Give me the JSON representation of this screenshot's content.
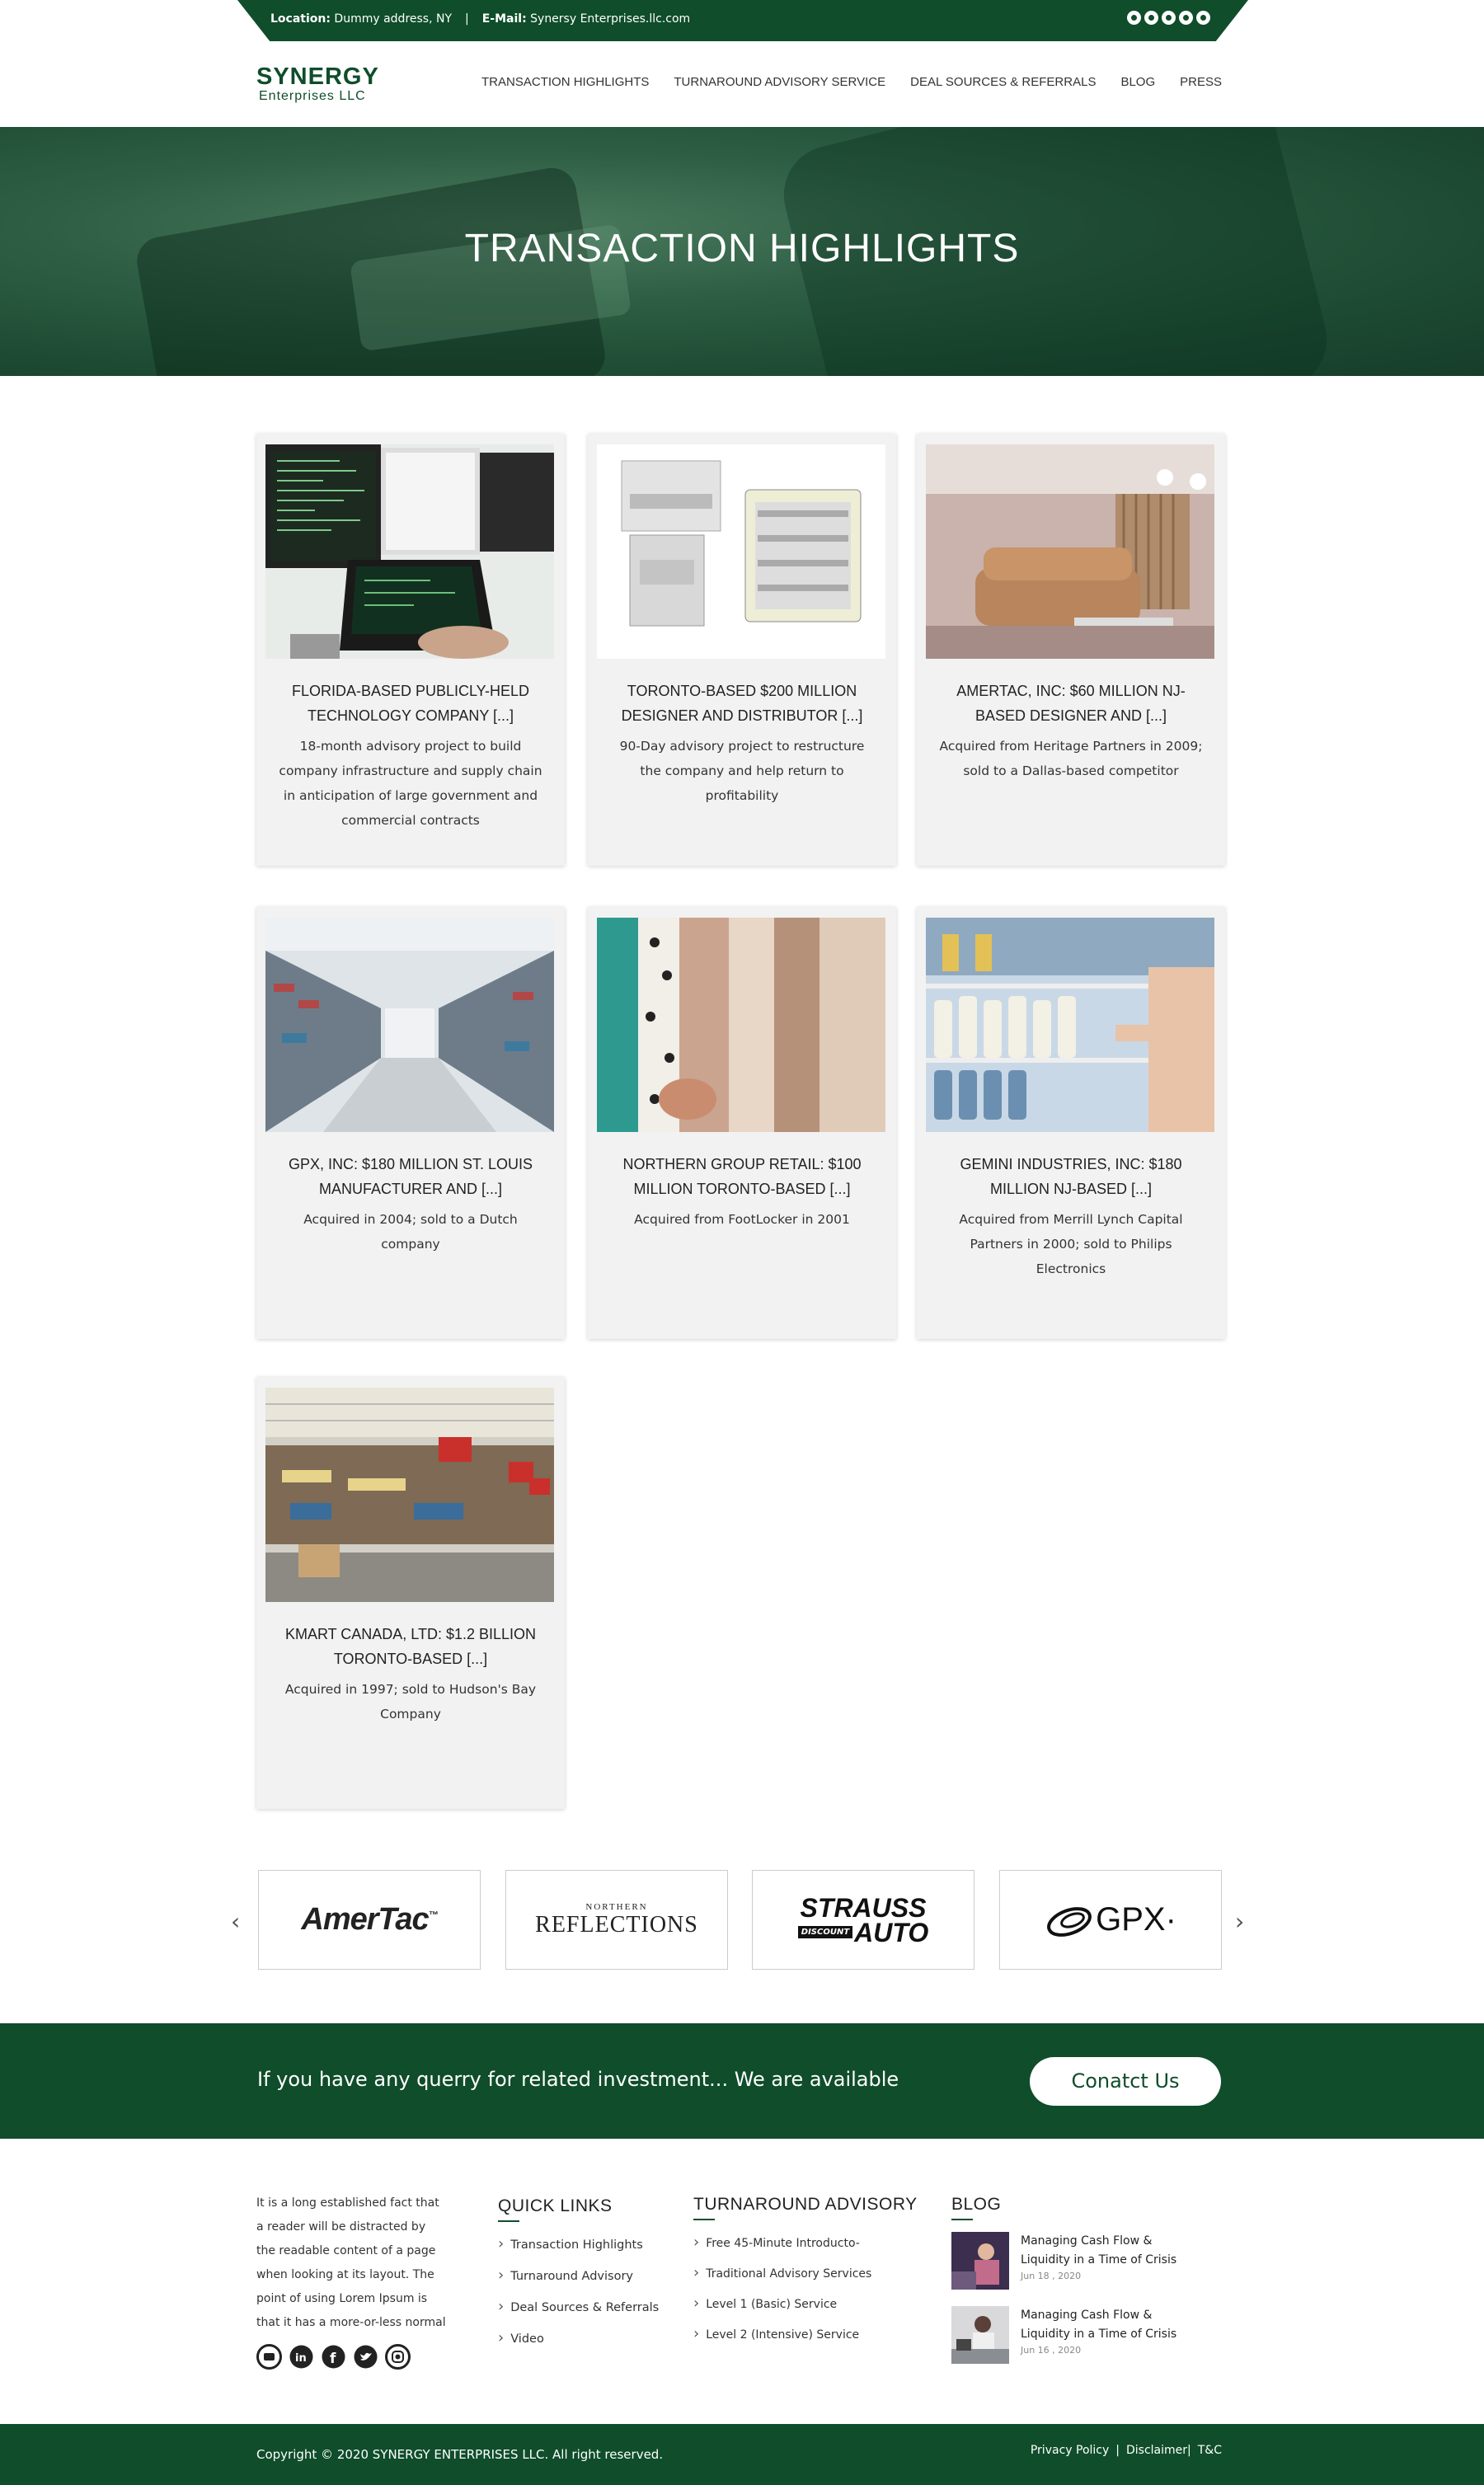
{
  "topbar": {
    "location_label": "Location:",
    "location_value": "Dummy address, NY",
    "separator": "|",
    "email_label": "E-Mail:",
    "email_value": "Synersy Enterprises.llc.com",
    "social_icons": [
      "youtube-icon",
      "linkedin-icon",
      "facebook-icon",
      "twitter-icon",
      "instagram-icon"
    ]
  },
  "brand": {
    "name": "SYNERGY",
    "sub": "Enterprises LLC",
    "color": "#0f4d2b"
  },
  "nav": [
    "TRANSACTION HIGHLIGHTS",
    "TURNAROUND ADVISORY SERVICE",
    "DEAL SOURCES & REFERRALS",
    "BLOG",
    "PRESS"
  ],
  "hero": {
    "title": "TRANSACTION HIGHLIGHTS"
  },
  "cards": [
    {
      "title": "FLORIDA-BASED PUBLICLY-HELD TECHNOLOGY COMPANY [...]",
      "desc": "18-month advisory project to build company infrastructure and supply chain in anticipation of large government and commercial contracts",
      "image": "computer-monitors-image"
    },
    {
      "title": "TORONTO-BASED $200 MILLION DESIGNER AND DISTRIBUTOR  [...]",
      "desc": "90-Day advisory project to restructure the company and help return to profitability",
      "image": "electrical-panels-image"
    },
    {
      "title": "AMERTAC, INC:   $60 MILLION NJ-BASED DESIGNER AND  [...]",
      "desc": "Acquired from Heritage Partners in 2009; sold to a Dallas-based competitor",
      "image": "living-room-image"
    },
    {
      "title": "GPX, INC:  $180 MILLION ST. LOUIS MANUFACTURER AND  [...]",
      "desc": "Acquired in 2004; sold to a Dutch company",
      "image": "store-aisle-image"
    },
    {
      "title": "NORTHERN GROUP RETAIL:  $100 MILLION TORONTO-BASED [...]",
      "desc": "Acquired from FootLocker in 2001",
      "image": "clothing-rack-image"
    },
    {
      "title": "GEMINI INDUSTRIES, INC:  $180 MILLION NJ-BASED  [...]",
      "desc": "Acquired from Merrill Lynch Capital Partners in 2000; sold to Philips Electronics",
      "image": "shelf-bottles-image"
    },
    {
      "title": "KMART CANADA, LTD:  $1.2 BILLION TORONTO-BASED  [...]",
      "desc": "Acquired in 1997; sold to Hudson's Bay Company",
      "image": "supermarket-image"
    }
  ],
  "partner_logos": [
    {
      "text": "AmerTac",
      "mark": "™"
    },
    {
      "small": "NORTHERN",
      "text": "REFLECTIONS"
    },
    {
      "top": "STRAUSS",
      "badge": "DISCOUNT",
      "bottom": "AUTO"
    },
    {
      "text": "GPX",
      "mark": "·"
    }
  ],
  "cta": {
    "text": "If you have any querry for related investment... We are available",
    "button": "Conatct Us"
  },
  "footer": {
    "about": "It is a long established fact that a reader will be distracted by the readable content of a page when looking at its layout. The point of using Lorem Ipsum is that it has a more-or-less normal",
    "quick_links": {
      "title": "QUICK LINKS",
      "items": [
        "Transaction Highlights",
        "Turnaround Advisory",
        "Deal Sources & Referrals",
        "Video"
      ]
    },
    "turnaround": {
      "title": "TURNAROUND ADVISORY",
      "items": [
        "Free 45-Minute Introducto-",
        "Traditional Advisory Services",
        "Level 1 (Basic) Service",
        "Level 2 (Intensive) Service"
      ]
    },
    "blog": {
      "title": "BLOG",
      "posts": [
        {
          "title": "Managing Cash Flow & Liquidity in a Time of Crisis",
          "date": "Jun 18 , 2020"
        },
        {
          "title": "Managing Cash Flow & Liquidity in a Time of Crisis",
          "date": "Jun 16 , 2020"
        }
      ]
    }
  },
  "bottom": {
    "copyright": "Copyright © 2020 SYNERGY ENTERPRISES LLC. All right reserved.",
    "links": [
      "Privacy Policy",
      "Disclaimer",
      "T&C"
    ],
    "sep1": "|",
    "sep2": "|"
  }
}
